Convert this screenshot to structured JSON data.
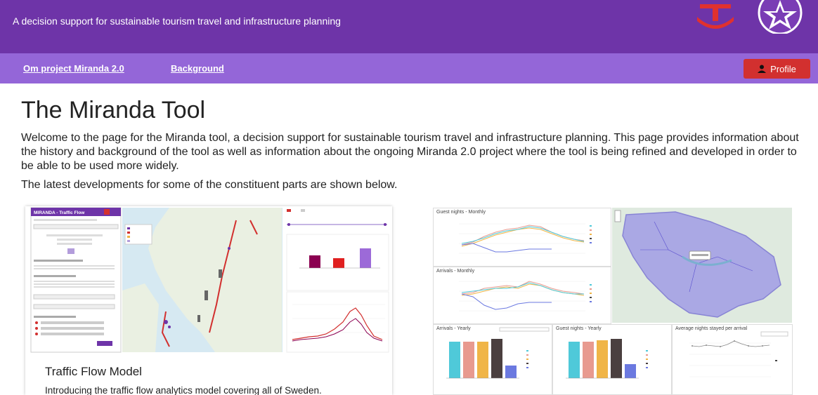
{
  "header": {
    "tagline": "A decision support for sustainable tourism travel and infrastructure planning",
    "logo_left_icon": "t-logo-icon",
    "logo_right_icon": "star-logo-icon"
  },
  "nav": {
    "items": [
      {
        "label": "Om project Miranda 2.0"
      },
      {
        "label": "Background"
      }
    ],
    "profile_label": "Profile",
    "profile_icon": "user-icon"
  },
  "main": {
    "title": "The Miranda Tool",
    "intro": "Welcome to the page for the Miranda tool, a decision support for sustainable tourism travel and infrastructure planning. This page provides information about the history and background of the tool as well as information about the ongoing Miranda 2.0 project where the tool is being refined and developed in order to be able to be used more widely.",
    "latest": "The latest developments for some of the constituent parts are shown below."
  },
  "cards": {
    "traffic": {
      "app_title": "MIRANDA - Traffic Flow",
      "title": "Traffic Flow Model",
      "description": "Introducing the traffic flow analytics model covering all of Sweden."
    },
    "stats": {
      "panel_titles": [
        "Guest nights - Monthly",
        "Arrivals - Monthly",
        "Arrivals - Yearly",
        "Guest nights - Yearly",
        "Average nights stayed per arrival"
      ],
      "legend_years": [
        "2019",
        "2020",
        "2021",
        "2022",
        "2023"
      ]
    }
  },
  "colors": {
    "topbar": "#6e34a8",
    "navbar": "#9466d8",
    "profile": "#d2302f",
    "bars": [
      "#4fc9d9",
      "#e89a8f",
      "#f0b547",
      "#4a3f3f",
      "#6b79e0"
    ]
  }
}
